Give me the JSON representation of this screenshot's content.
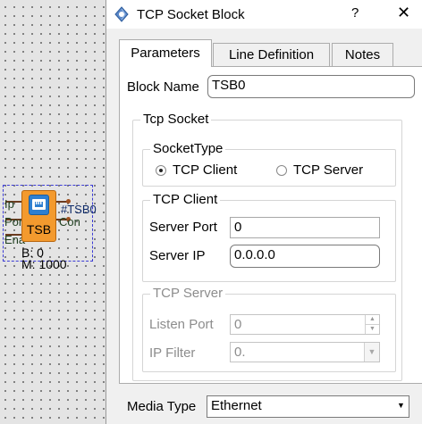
{
  "canvas": {
    "block": {
      "name": "TSB",
      "tag": "#TSB0",
      "left_pins": [
        "Ip",
        "Por",
        "Ena"
      ],
      "right_pins": [
        "Con"
      ],
      "params": [
        "B: 0",
        "M: 1000"
      ]
    }
  },
  "dialog": {
    "title": "TCP Socket Block",
    "help": "?",
    "close": "✕",
    "tabs": [
      "Parameters",
      "Line Definition",
      "Notes"
    ],
    "block_name_label": "Block Name",
    "block_name_value": "TSB0",
    "tcp_socket": {
      "title": "Tcp Socket",
      "socket_type": {
        "title": "SocketType",
        "options": [
          {
            "label": "TCP Client",
            "checked": true
          },
          {
            "label": "TCP Server",
            "checked": false
          }
        ]
      },
      "tcp_client": {
        "title": "TCP Client",
        "server_port_label": "Server Port",
        "server_port_value": "0",
        "server_ip_label": "Server IP",
        "server_ip_value": "0.0.0.0"
      },
      "tcp_server": {
        "title": "TCP Server",
        "listen_port_label": "Listen Port",
        "listen_port_value": "0",
        "ip_filter_label": "IP Filter",
        "ip_filter_value": "0."
      }
    },
    "media_type_label": "Media Type",
    "media_type_value": "Ethernet"
  },
  "colors": {
    "block_fill": "#f39a2e",
    "icon_blue": "#2e7fd0",
    "selection": "#3b3bd6",
    "dialog_bg": "#f0f0f0"
  }
}
